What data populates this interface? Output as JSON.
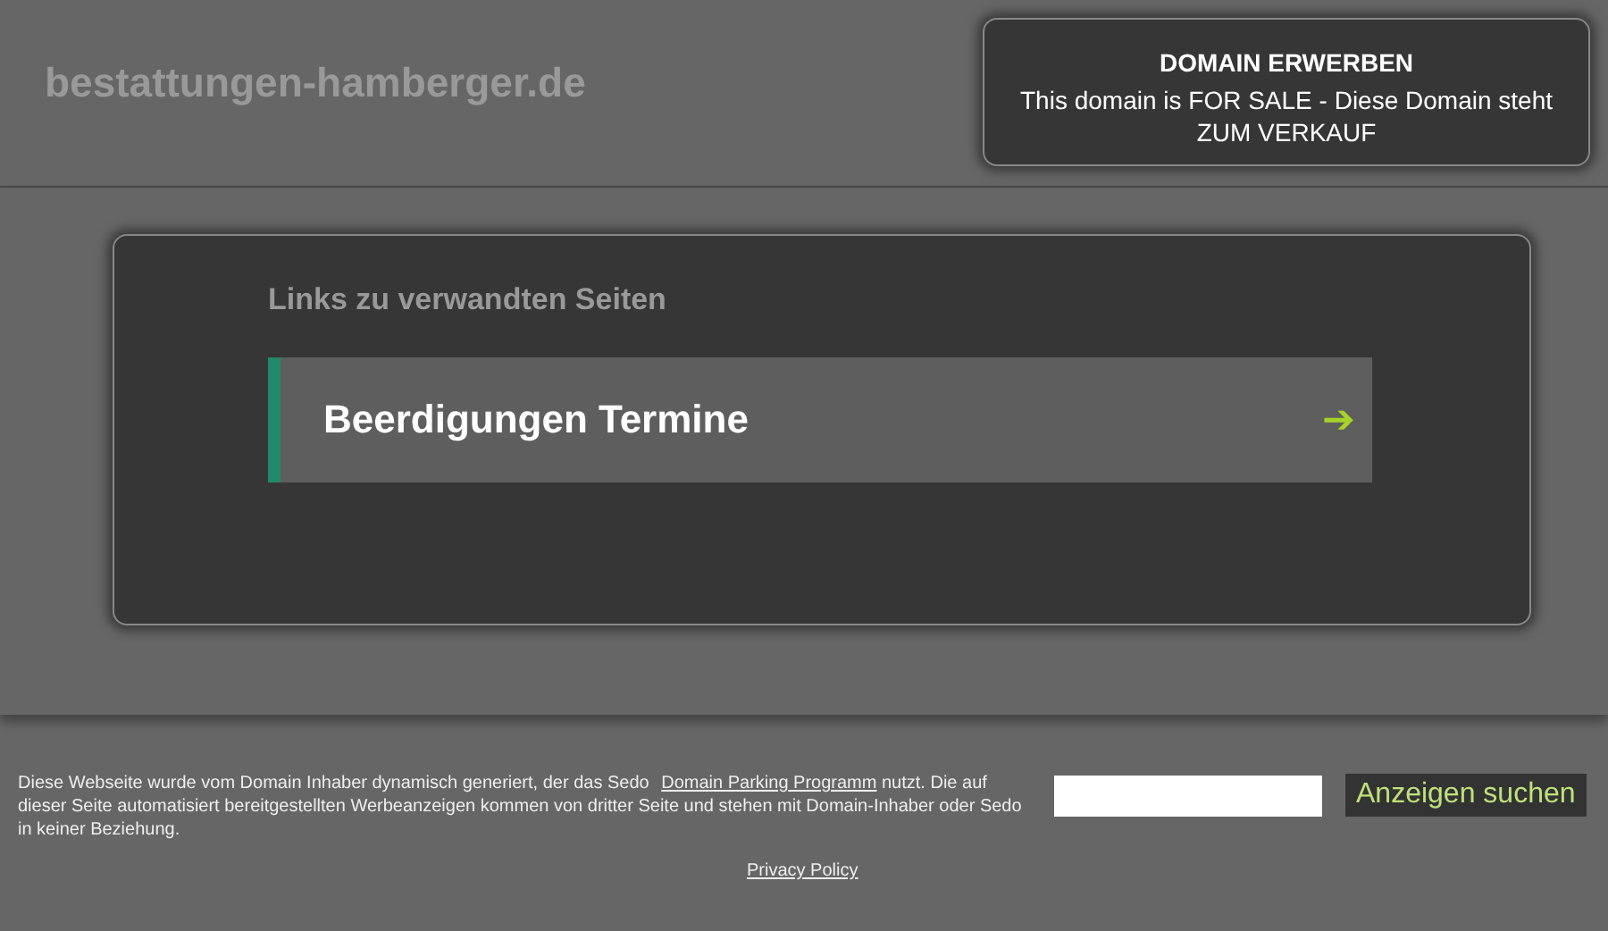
{
  "site_title": "bestattungen-hamberger.de",
  "sale_box": {
    "title": "DOMAIN ERWERBEN",
    "text": "This domain is FOR SALE - Diese Domain steht ZUM VERKAUF"
  },
  "related": {
    "heading": "Links zu verwandten Seiten",
    "links": [
      {
        "label": "Beerdigungen Termine",
        "arrow": "➔"
      }
    ]
  },
  "footer": {
    "disclaimer_before": "Diese Webseite wurde vom Domain Inhaber dynamisch generiert, der das Sedo ",
    "disclaimer_link": "Domain Parking Programm",
    "disclaimer_after": " nutzt. Die auf dieser Seite automatisiert bereitgestellten Werbeanzeigen kommen von dritter Seite und stehen mit Domain-Inhaber oder Sedo in keiner Beziehung.",
    "search_button": "Anzeigen suchen",
    "privacy": "Privacy Policy"
  }
}
